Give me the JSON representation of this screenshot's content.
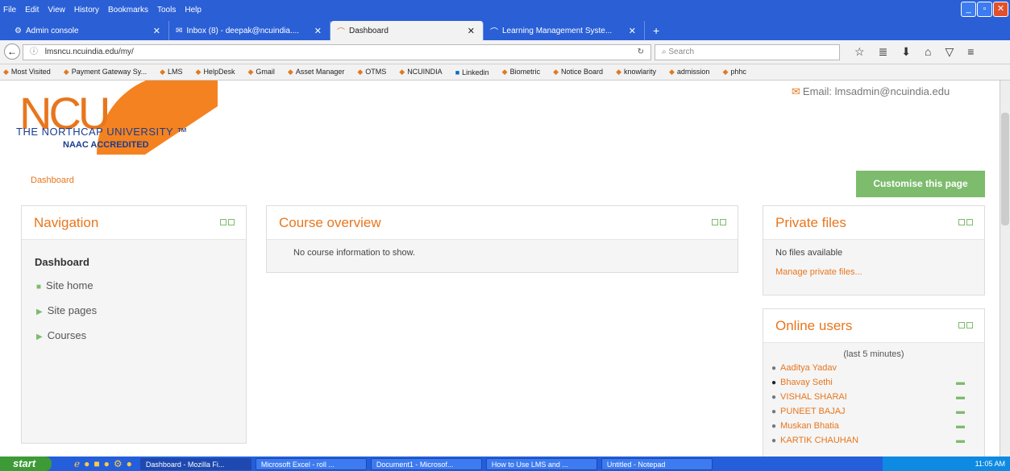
{
  "menubar": {
    "items": [
      "File",
      "Edit",
      "View",
      "History",
      "Bookmarks",
      "Tools",
      "Help"
    ]
  },
  "tabs": [
    {
      "label": "Admin console"
    },
    {
      "label": "Inbox (8) - deepak@ncuindia...."
    },
    {
      "label": "Dashboard"
    },
    {
      "label": "Learning Management Syste..."
    }
  ],
  "navbar": {
    "url": "lmsncu.ncuindia.edu/my/",
    "search_placeholder": "Search"
  },
  "bookmarks": [
    "Most Visited",
    "Payment Gateway Sy...",
    "LMS",
    "HelpDesk",
    "Gmail",
    "Asset Manager",
    "OTMS",
    "NCUINDIA",
    "Linkedin",
    "Biometric",
    "Notice Board",
    "knowlarity",
    "admission",
    "phhc"
  ],
  "logo": {
    "letters": "NCU",
    "name": "THE NORTHCAP UNIVERSITY ™",
    "accreditation": "NAAC ACCREDITED"
  },
  "header": {
    "email": "Email: lmsadmin@ncuindia.edu"
  },
  "breadcrumb": "Dashboard",
  "customise_label": "Customise this page",
  "navigation": {
    "title": "Navigation",
    "root": "Dashboard",
    "items": [
      "Site home",
      "Site pages",
      "Courses"
    ]
  },
  "course_overview": {
    "title": "Course overview",
    "message": "No course information to show."
  },
  "private_files": {
    "title": "Private files",
    "message": "No files available",
    "link": "Manage private files..."
  },
  "online_users": {
    "title": "Online users",
    "subtitle": "(last 5 minutes)",
    "users": [
      "Aaditya Yadav",
      "Bhavay Sethi",
      "VISHAL SHARAI",
      "PUNEET BAJAJ",
      "Muskan Bhatia",
      "KARTIK CHAUHAN"
    ]
  },
  "taskbar": {
    "start": "start",
    "tasks": [
      "Dashboard - Mozilla Fi...",
      "Microsoft Excel - roll ...",
      "Document1 - Microsof...",
      "How to Use LMS and ...",
      "Untitled - Notepad"
    ],
    "clock": "11:05 AM"
  }
}
